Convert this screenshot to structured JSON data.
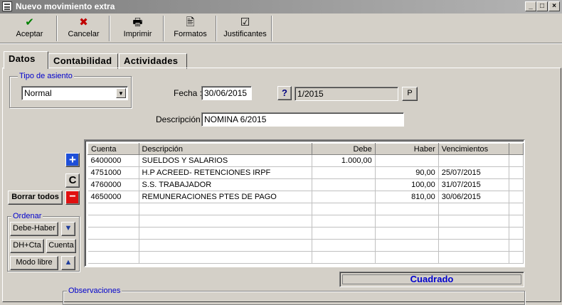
{
  "window": {
    "title": "Nuevo movimiento extra",
    "min": "_",
    "max": "□",
    "close": "×"
  },
  "toolbar": [
    {
      "label": "Aceptar",
      "icon": "✔",
      "color": "#008000"
    },
    {
      "label": "Cancelar",
      "icon": "✖",
      "color": "#c00000"
    },
    {
      "label": "Imprimir",
      "icon": "🖶",
      "color": "#000000"
    },
    {
      "label": "Formatos",
      "icon": "🖹",
      "color": "#000000"
    },
    {
      "label": "Justificantes",
      "icon": "☑",
      "color": "#000000"
    }
  ],
  "tabs": [
    {
      "label": "Datos"
    },
    {
      "label": "Contabilidad"
    },
    {
      "label": "Actividades"
    }
  ],
  "tipo_asiento": {
    "group_label": "Tipo de asiento",
    "value": "Normal"
  },
  "fecha": {
    "label": "Fecha :",
    "value": "30/06/2015",
    "help": "?",
    "periodo": "1/2015",
    "p_button": "P"
  },
  "descripcion": {
    "label": "Descripción :",
    "value": "NOMINA 6/2015"
  },
  "side": {
    "add_icon": "+",
    "copy_icon": "C",
    "borrar_todos": "Borrar todos",
    "delete_icon": "−",
    "ordenar_label": "Ordenar",
    "debe_haber": "Debe-Haber",
    "down_icon": "▼",
    "dh_cta": "DH+Cta",
    "cuenta": "Cuenta",
    "modo_libre": "Modo libre",
    "up_icon": "▲"
  },
  "grid": {
    "columns": [
      "Cuenta",
      "Descripción",
      "Debe",
      "Haber",
      "Vencimientos"
    ],
    "rows": [
      [
        "6400000",
        "SUELDOS Y SALARIOS",
        "1.000,00",
        "",
        ""
      ],
      [
        "4751000",
        "H.P ACREED- RETENCIONES IRPF",
        "",
        "90,00",
        "25/07/2015"
      ],
      [
        "4760000",
        "S.S. TRABAJADOR",
        "",
        "100,00",
        "31/07/2015"
      ],
      [
        "4650000",
        "REMUNERACIONES PTES DE PAGO",
        "",
        "810,00",
        "30/06/2015"
      ]
    ]
  },
  "status": "Cuadrado",
  "observaciones_label": "Observaciones"
}
